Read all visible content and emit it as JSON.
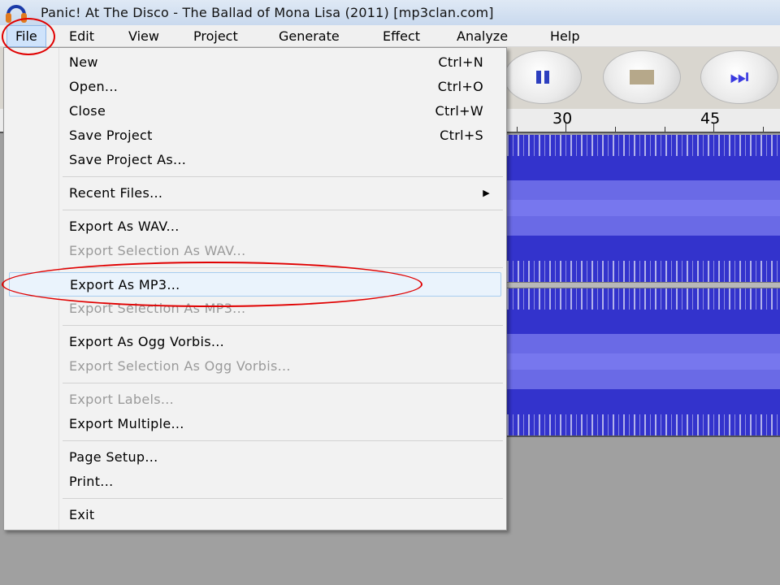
{
  "window": {
    "title": "Panic! At The Disco - The Ballad of Mona Lisa (2011) [mp3clan.com]",
    "app_icon": "headphones-icon"
  },
  "menubar": {
    "items": [
      "File",
      "Edit",
      "View",
      "Project",
      "Generate",
      "Effect",
      "Analyze",
      "Help"
    ]
  },
  "toolbar": {
    "buttons": [
      "pause-icon",
      "stop-icon",
      "skip-end-icon"
    ]
  },
  "ruler": {
    "labels": [
      "30",
      "45"
    ]
  },
  "file_menu": {
    "items": [
      {
        "label": "New",
        "shortcut": "Ctrl+N"
      },
      {
        "label": "Open...",
        "shortcut": "Ctrl+O"
      },
      {
        "label": "Close",
        "shortcut": "Ctrl+W"
      },
      {
        "label": "Save Project",
        "shortcut": "Ctrl+S"
      },
      {
        "label": "Save Project As..."
      },
      {
        "label": "Recent Files..."
      },
      {
        "label": "Export As WAV..."
      },
      {
        "label": "Export Selection As WAV..."
      },
      {
        "label": "Export As MP3..."
      },
      {
        "label": "Export Selection As MP3..."
      },
      {
        "label": "Export As Ogg Vorbis..."
      },
      {
        "label": "Export Selection As Ogg Vorbis..."
      },
      {
        "label": "Export Labels..."
      },
      {
        "label": "Export Multiple..."
      },
      {
        "label": "Page Setup..."
      },
      {
        "label": "Print..."
      },
      {
        "label": "Exit"
      }
    ]
  },
  "colors": {
    "waveform": "#3333cc",
    "annotation": "#e00000",
    "highlight": "#eaf3fc"
  }
}
